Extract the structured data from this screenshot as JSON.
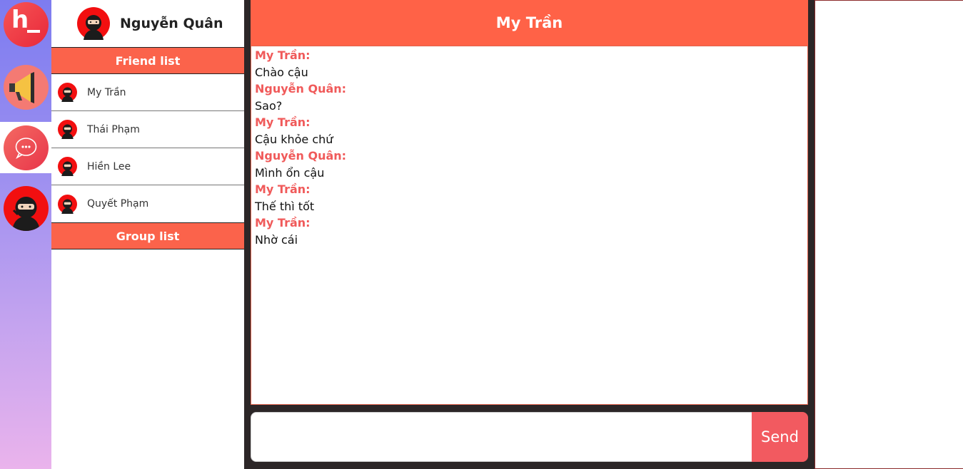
{
  "rail": {
    "logo_letter": "h",
    "items": [
      "logo",
      "announcements",
      "messages",
      "profile"
    ]
  },
  "user": {
    "name": "Nguyễn Quân"
  },
  "friend_list": {
    "title": "Friend list",
    "friends": [
      {
        "name": "My Trần"
      },
      {
        "name": "Thái Phạm"
      },
      {
        "name": "Hiền Lee"
      },
      {
        "name": "Quyết Phạm"
      }
    ]
  },
  "group_list": {
    "title": "Group list"
  },
  "chat": {
    "title": "My Trần",
    "messages": [
      {
        "sender": "My Trần:",
        "text": "Chào cậu"
      },
      {
        "sender": "Nguyễn Quân:",
        "text": "Sao?"
      },
      {
        "sender": "My Trần:",
        "text": "Cậu khỏe chứ"
      },
      {
        "sender": "Nguyễn Quân:",
        "text": "Mình ổn cậu"
      },
      {
        "sender": "My Trần:",
        "text": "Thế thì tốt"
      },
      {
        "sender": "My Trần:",
        "text": "Nhờ cái"
      }
    ],
    "input_value": "",
    "send_label": "Send"
  },
  "colors": {
    "accent": "#fb634b",
    "sender": "#f05a5a",
    "send_button": "#f25a60",
    "chat_bg": "#2c2627"
  }
}
